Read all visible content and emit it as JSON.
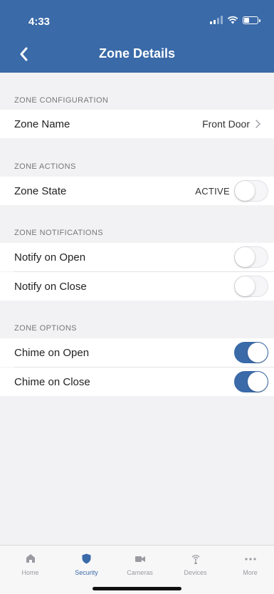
{
  "status_bar": {
    "time": "4:33"
  },
  "header": {
    "title": "Zone Details",
    "back_icon": "chevron-left-icon"
  },
  "sections": {
    "configuration": {
      "header": "ZONE CONFIGURATION",
      "rows": [
        {
          "label": "Zone Name",
          "value": "Front Door"
        }
      ]
    },
    "actions": {
      "header": "ZONE ACTIONS",
      "rows": [
        {
          "label": "Zone State",
          "state": "ACTIVE",
          "toggle_on": false
        }
      ]
    },
    "notifications": {
      "header": "ZONE NOTIFICATIONS",
      "rows": [
        {
          "label": "Notify on Open",
          "toggle_on": false
        },
        {
          "label": "Notify on Close",
          "toggle_on": false
        }
      ]
    },
    "options": {
      "header": "ZONE OPTIONS",
      "rows": [
        {
          "label": "Chime on Open",
          "toggle_on": true
        },
        {
          "label": "Chime on Close",
          "toggle_on": true
        }
      ]
    }
  },
  "tabbar": {
    "active": "Security",
    "items": [
      {
        "label": "Home",
        "icon": "home-icon"
      },
      {
        "label": "Security",
        "icon": "shield-icon"
      },
      {
        "label": "Cameras",
        "icon": "camera-icon"
      },
      {
        "label": "Devices",
        "icon": "wifi-device-icon"
      },
      {
        "label": "More",
        "icon": "more-dots-icon"
      }
    ]
  },
  "colors": {
    "accent": "#3a6aa8",
    "background": "#f2f2f4",
    "inactive_tab": "#9a9aa0"
  }
}
